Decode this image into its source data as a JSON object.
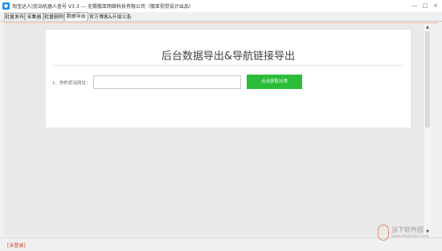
{
  "window": {
    "title": "淘宝达人|优站机器人查号 V3.3  ---  无锡俄亚网络科技有限公司（俄亚视觉设计出品）",
    "minimize_label": "—",
    "maximize_label": "□",
    "close_label": "×"
  },
  "tabs": [
    {
      "label": "批量发布"
    },
    {
      "label": "采集器"
    },
    {
      "label": "批量删除"
    },
    {
      "label": "数据导出"
    },
    {
      "label": "官方博客&升级公告"
    }
  ],
  "active_tab": "数据导出",
  "main": {
    "heading": "后台数据导出&导航链接导出",
    "field_label": "1、你的优站网址：",
    "url_value": "",
    "fetch_button_label": "点击获取分类"
  },
  "status": {
    "login_text": "[未登录]"
  },
  "watermark": {
    "text": "当下软件园",
    "url": "www.downxia.com"
  },
  "colors": {
    "accent_green": "#2bbd39",
    "status_red": "#e03b1b",
    "tab_underline": "#f0b898"
  }
}
